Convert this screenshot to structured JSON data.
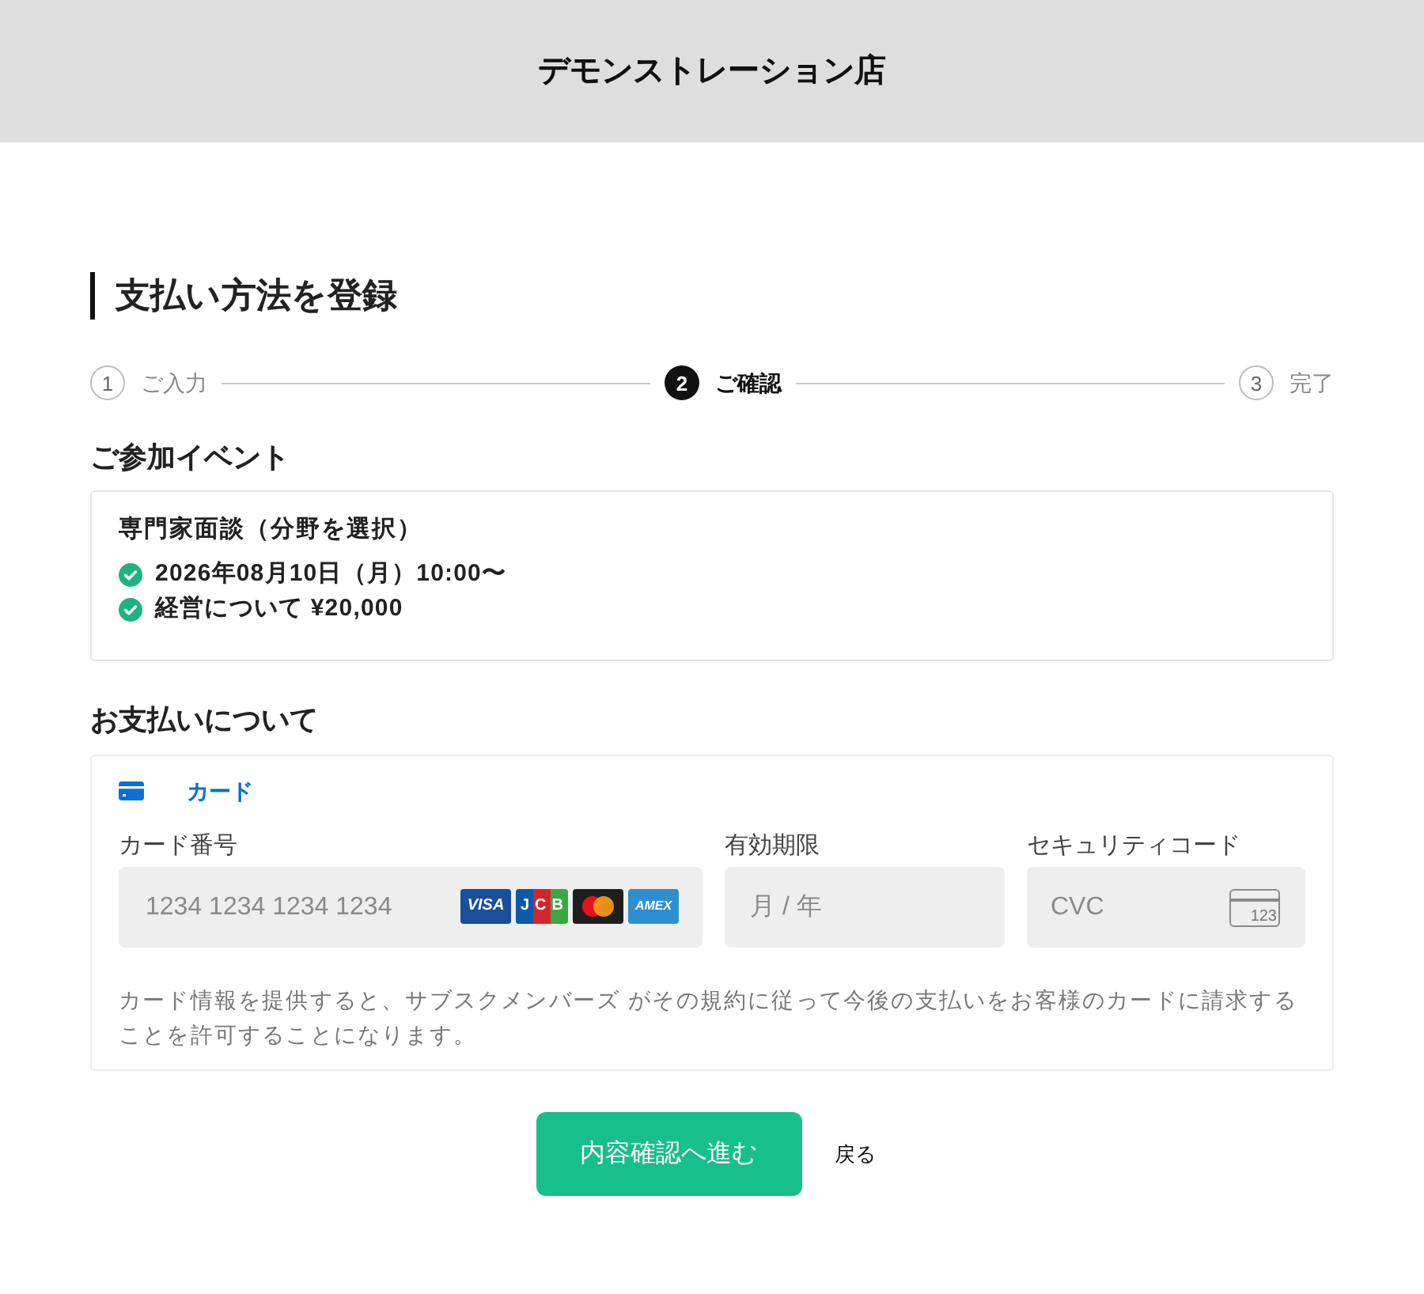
{
  "header": {
    "title": "デモンストレーション店"
  },
  "page": {
    "title": "支払い方法を登録"
  },
  "steps": [
    {
      "number": "1",
      "label": "ご入力",
      "selected": false
    },
    {
      "number": "2",
      "label": "ご確認",
      "selected": true
    },
    {
      "number": "3",
      "label": "完了",
      "selected": false
    }
  ],
  "event_section": {
    "title": "ご参加イベント",
    "event_name": "専門家面談（分野を選択）",
    "items": [
      "2026年08月10日（月）10:00〜",
      "経営について ¥20,000"
    ]
  },
  "payment_section": {
    "title": "お支払いについて",
    "methods": [
      {
        "label": "カード",
        "selected": true
      }
    ],
    "card_number": {
      "label": "カード番号",
      "placeholder": "1234 1234 1234 1234",
      "brands": [
        {
          "kind": "visa",
          "label": "VISA"
        },
        {
          "kind": "jcb",
          "label": "JCB"
        },
        {
          "kind": "mastercard"
        },
        {
          "kind": "amex",
          "label": "AMEX"
        }
      ]
    },
    "expiry": {
      "label": "有効期限",
      "placeholder": "月 / 年"
    },
    "cvc": {
      "label": "セキュリティコード",
      "placeholder": "CVC",
      "icon_label": "123"
    },
    "note": "カード情報を提供すると、サブスクメンバーズ がその規約に従って今後の支払いをお客様のカードに請求することを許可することになります。"
  },
  "actions": {
    "submit": "内容確認へ進む",
    "back": "戻る"
  }
}
